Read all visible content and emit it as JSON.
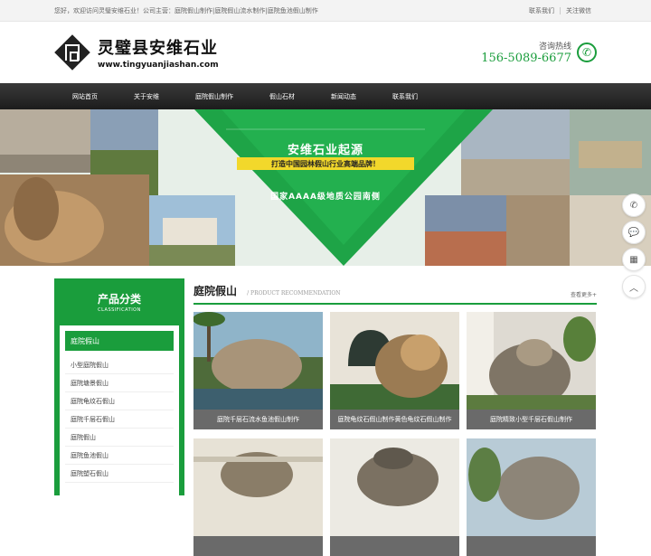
{
  "topbar": {
    "welcome": "您好，欢迎访问灵璧安维石业！公司主营：庭院假山制作|庭院假山流水制作|庭院鱼池假山制作",
    "links": [
      "联系我们",
      "关注微信"
    ]
  },
  "header": {
    "logo_name": "灵璧县安维石业",
    "logo_url": "www.tingyuanjiashan.com",
    "hotline_label": "咨询热线",
    "hotline_number": "156-5089-6677"
  },
  "nav": [
    "网站首页",
    "关于安维",
    "庭院假山制作",
    "假山石材",
    "新闻动态",
    "联系我们"
  ],
  "banner": {
    "title": "安维石业起源",
    "slogan": "打造中国园林假山行业高端品牌！",
    "subtitle": "国家AAAA级地质公园南侧"
  },
  "float_tools": [
    "phone-icon",
    "chat-icon",
    "qrcode-icon",
    "back-to-top-icon"
  ],
  "sidebar": {
    "title": "产品分类",
    "title_en": "CLASSIFICATION",
    "active": "庭院假山",
    "items": [
      "小型庭院假山",
      "庭院塘景假山",
      "庭院龟纹石假山",
      "庭院千层石假山",
      "庭院假山",
      "庭院鱼池假山",
      "庭院塑石假山"
    ]
  },
  "section": {
    "title": "庭院假山",
    "title_en": "/ PRODUCT RECOMMENDATION",
    "more": "查看更多+",
    "products": [
      {
        "caption": "庭院千层石流水鱼池假山制作"
      },
      {
        "caption": "庭院龟纹石假山制作黄色龟纹石假山制作"
      },
      {
        "caption": "庭院精致小型千层石假山制作"
      },
      {
        "caption": ""
      },
      {
        "caption": ""
      },
      {
        "caption": ""
      }
    ]
  },
  "colors": {
    "brand_green": "#1a9d3c",
    "nav_dark": "#2a2a2a",
    "slogan_yellow": "#f2d82b"
  }
}
